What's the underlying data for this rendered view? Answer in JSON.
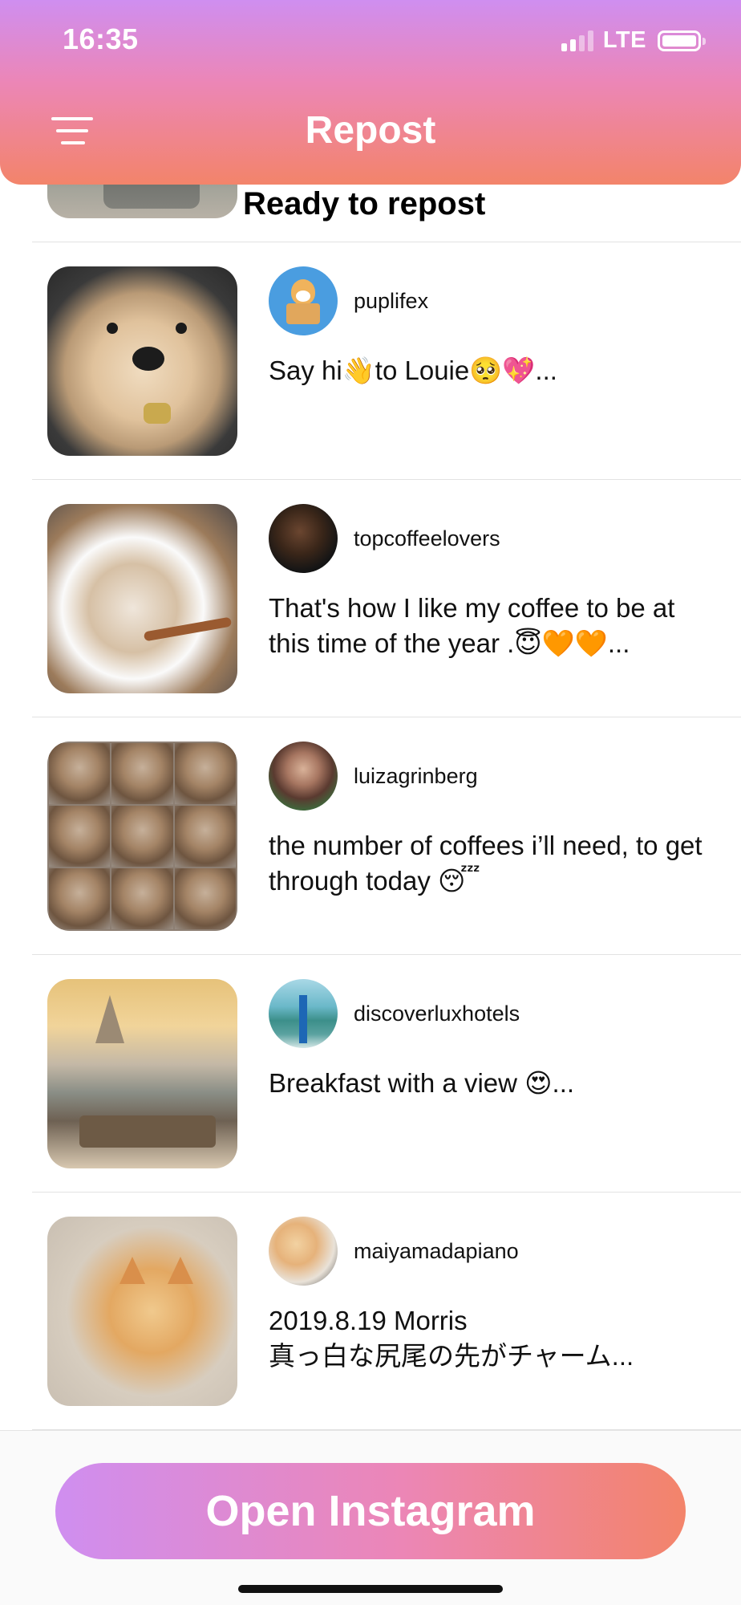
{
  "status_bar": {
    "time": "16:35",
    "network": "LTE"
  },
  "header": {
    "title": "Repost",
    "menu_icon": "hamburger-menu-icon"
  },
  "ready_label": "Ready to repost",
  "posts": [
    {
      "username": "puplifex",
      "caption": "Say hi👋to Louie🥺💖...",
      "thumb": "golden-retriever-puppy",
      "avatar": "corgi-in-box"
    },
    {
      "username": "topcoffeelovers",
      "caption": "That's how I like my coffee to be at this time of the year .😇🧡🧡...",
      "thumb": "cappuccino-cups",
      "avatar": "coffee-beans-cup"
    },
    {
      "username": "luizagrinberg",
      "caption": "the number of coffees i’ll need, to get through today 😴",
      "thumb": "iced-coffee-grid",
      "avatar": "woman-portrait"
    },
    {
      "username": "discoverluxhotels",
      "caption": "Breakfast with a view 😍...",
      "thumb": "budapest-breakfast-view",
      "avatar": "tropical-pool"
    },
    {
      "username": "maiyamadapiano",
      "caption": "2019.8.19 Morris\n真っ白な尻尾の先がチャーム...",
      "thumb": "ginger-cat",
      "avatar": "cat-piano"
    }
  ],
  "footer": {
    "button_label": "Open Instagram"
  },
  "colors": {
    "gradient_start": "#cf8ef0",
    "gradient_mid": "#ec86b6",
    "gradient_end": "#f3846a"
  }
}
